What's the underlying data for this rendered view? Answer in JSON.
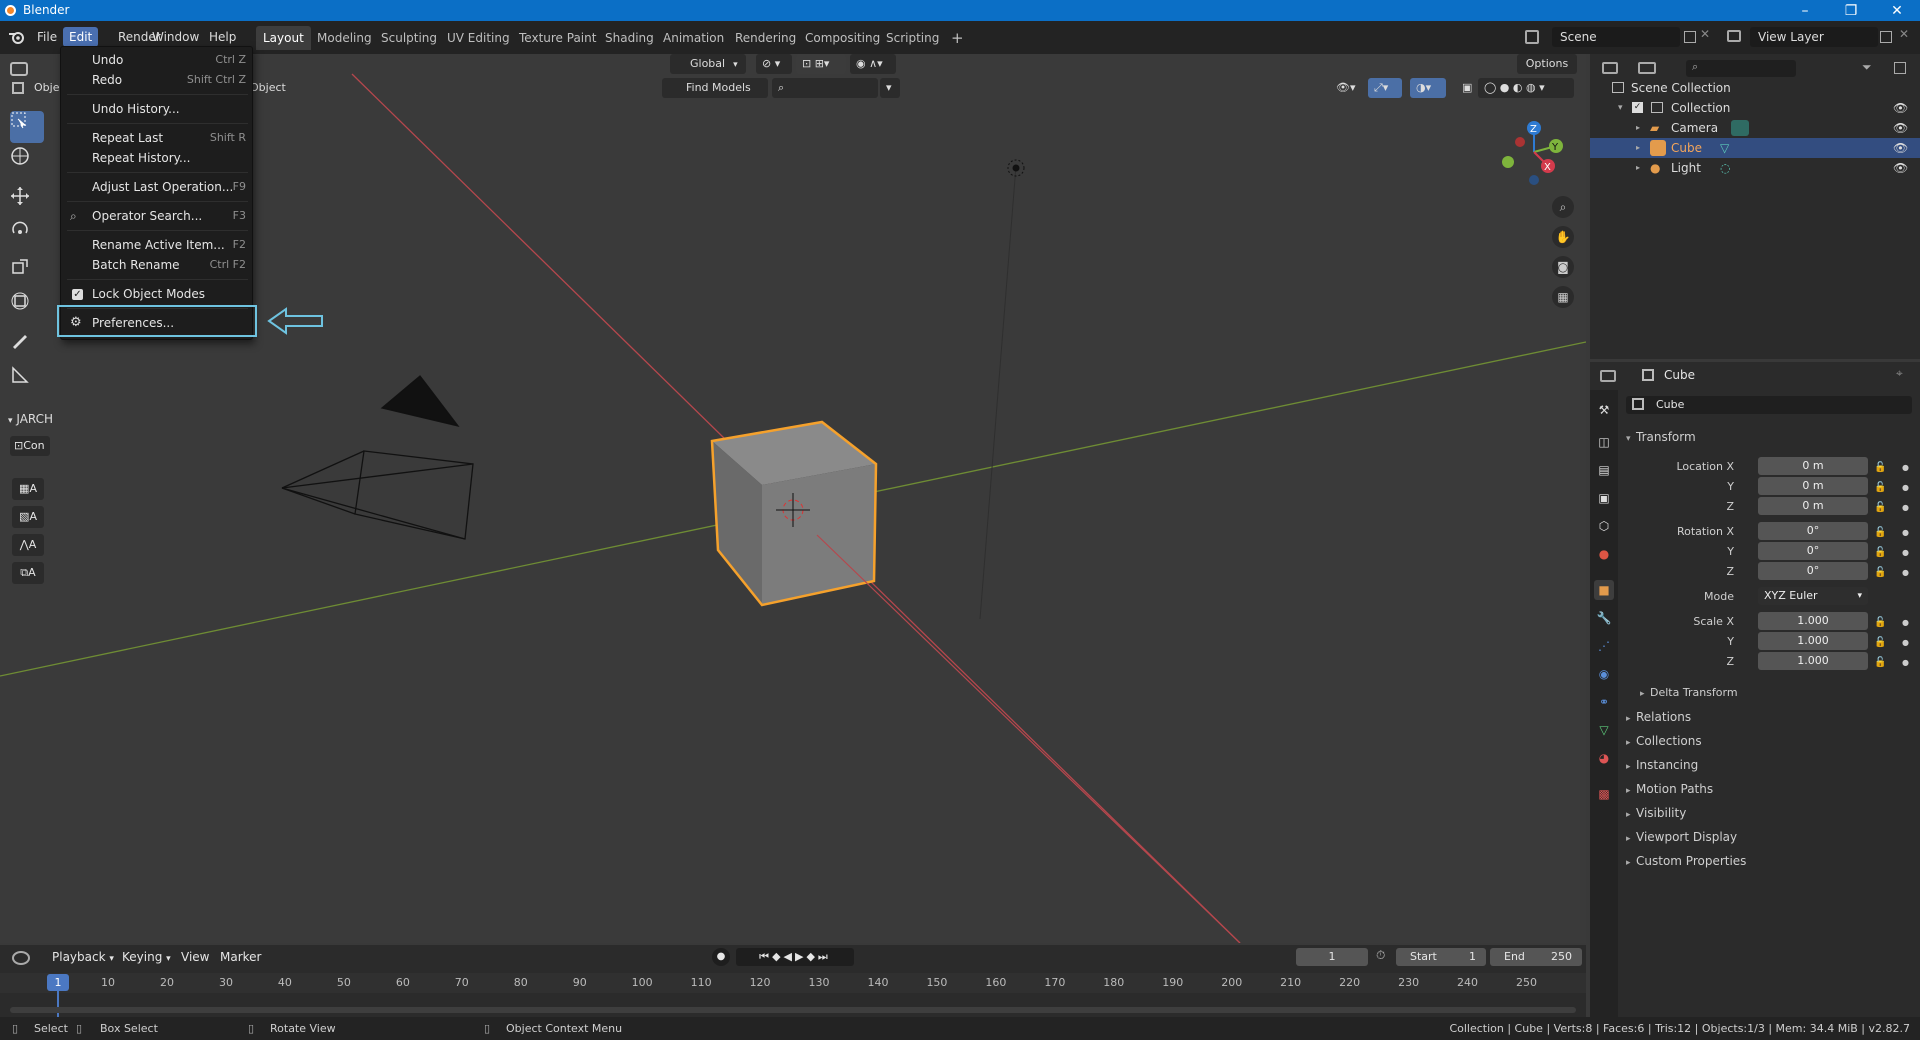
{
  "titlebar": {
    "title": "Blender",
    "min": "–",
    "restore": "❐",
    "close": "✕"
  },
  "menubar": {
    "items": [
      "File",
      "Edit",
      "Render",
      "Window",
      "Help"
    ],
    "active": "Edit"
  },
  "workspace_tabs": [
    "Layout",
    "Modeling",
    "Sculpting",
    "UV Editing",
    "Texture Paint",
    "Shading",
    "Animation",
    "Rendering",
    "Compositing",
    "Scripting"
  ],
  "workspace_add": "+",
  "scene": {
    "name": "Scene",
    "view_layer": "View Layer"
  },
  "viewport_header": {
    "mode_partial": "Object",
    "object_label": "Object",
    "orientation": "Global",
    "find_models": "Find Models",
    "options": "Options"
  },
  "edit_menu": {
    "items": [
      {
        "label": "Undo",
        "shortcut": "Ctrl Z"
      },
      {
        "label": "Redo",
        "shortcut": "Shift Ctrl Z"
      },
      {
        "label": "Undo History..."
      },
      {
        "label": "Repeat Last",
        "shortcut": "Shift R"
      },
      {
        "label": "Repeat History..."
      },
      {
        "label": "Adjust Last Operation...",
        "shortcut": "F9"
      },
      {
        "label": "Operator Search...",
        "shortcut": "F3"
      },
      {
        "label": "Rename Active Item...",
        "shortcut": "F2"
      },
      {
        "label": "Batch Rename",
        "shortcut": "Ctrl F2"
      },
      {
        "label": "Lock Object Modes",
        "checked": true
      },
      {
        "label": "Preferences..."
      }
    ]
  },
  "left_panel": {
    "jarch_label": "JARCH",
    "con_label": "Con",
    "btn_a": "A"
  },
  "gizmo": {
    "x": "X",
    "y": "Y",
    "z": "Z"
  },
  "outliner": {
    "root": "Scene Collection",
    "collection": "Collection",
    "items": [
      {
        "name": "Camera",
        "selected": false
      },
      {
        "name": "Cube",
        "selected": true
      },
      {
        "name": "Light",
        "selected": false
      }
    ]
  },
  "properties": {
    "header_object": "Cube",
    "object_name": "Cube",
    "transform_title": "Transform",
    "location_label": "Location X",
    "rotation_label": "Rotation X",
    "scale_label": "Scale X",
    "y_label": "Y",
    "z_label": "Z",
    "mode_label": "Mode",
    "location": [
      "0 m",
      "0 m",
      "0 m"
    ],
    "rotation": [
      "0°",
      "0°",
      "0°"
    ],
    "mode": "XYZ Euler",
    "scale": [
      "1.000",
      "1.000",
      "1.000"
    ],
    "delta_transform": "Delta Transform",
    "sections": [
      "Relations",
      "Collections",
      "Instancing",
      "Motion Paths",
      "Visibility",
      "Viewport Display",
      "Custom Properties"
    ]
  },
  "timeline": {
    "menus": [
      "Playback",
      "Keying",
      "View",
      "Marker"
    ],
    "current_frame": "1",
    "start_label": "Start",
    "start": "1",
    "end_label": "End",
    "end": "250",
    "ruler": [
      "1",
      "10",
      "20",
      "30",
      "40",
      "50",
      "60",
      "70",
      "80",
      "90",
      "100",
      "110",
      "120",
      "130",
      "140",
      "150",
      "160",
      "170",
      "180",
      "190",
      "200",
      "210",
      "220",
      "230",
      "240",
      "250"
    ]
  },
  "statusbar": {
    "select": "Select",
    "box_select": "Box Select",
    "rotate_view": "Rotate View",
    "context_menu": "Object Context Menu",
    "stats": "Collection | Cube | Verts:8 | Faces:6 | Tris:12 | Objects:1/3 | Mem: 34.4 MiB | v2.82.7"
  },
  "colors": {
    "accent": "#4a6fb0",
    "selection": "#f5a12c",
    "highlight_box": "#6ec3e0",
    "titlebar": "#0b6fc6"
  }
}
